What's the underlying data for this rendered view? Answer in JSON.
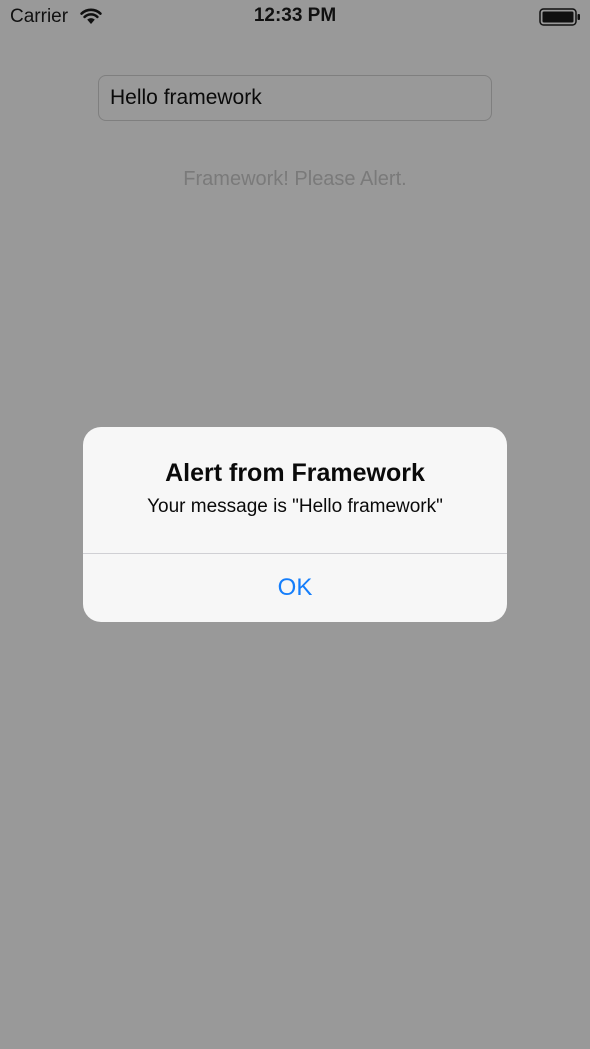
{
  "status_bar": {
    "carrier": "Carrier",
    "time": "12:33 PM",
    "wifi_icon": "wifi-icon",
    "battery_icon": "battery-icon"
  },
  "main": {
    "text_field_value": "Hello framework",
    "alert_button_label": "Framework! Please Alert."
  },
  "alert": {
    "title": "Alert from Framework",
    "message": "Your message is \"Hello framework\"",
    "ok_label": "OK"
  },
  "colors": {
    "background_dimmed": "#999999",
    "alert_background": "#f7f7f7",
    "tint": "#157efb"
  }
}
